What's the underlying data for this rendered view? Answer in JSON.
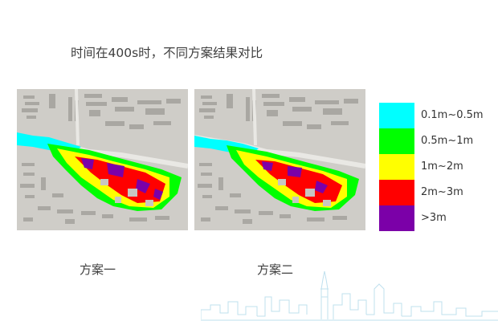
{
  "title": "时间在400s时，不同方案结果对比",
  "legend": {
    "items": [
      {
        "label": "0.1m~0.5m",
        "color": "#00ffff"
      },
      {
        "label": "0.5m~1m",
        "color": "#00ff00"
      },
      {
        "label": "1m~2m",
        "color": "#ffff00"
      },
      {
        "label": "2m~3m",
        "color": "#ff0000"
      },
      {
        "label": ">3m",
        "color": "#7b00a8"
      }
    ]
  },
  "panels": [
    {
      "caption": "方案一"
    },
    {
      "caption": "方案二"
    }
  ]
}
